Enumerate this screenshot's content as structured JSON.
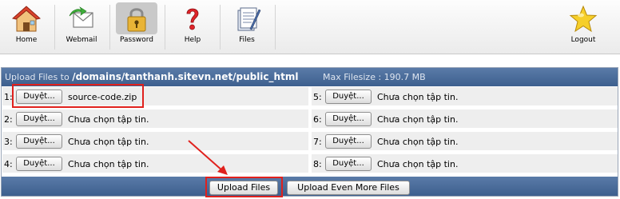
{
  "toolbar": {
    "items": [
      {
        "label": "Home",
        "icon": "home-icon"
      },
      {
        "label": "Webmail",
        "icon": "webmail-icon"
      },
      {
        "label": "Password",
        "icon": "lock-icon"
      },
      {
        "label": "Help",
        "icon": "help-icon"
      },
      {
        "label": "Files",
        "icon": "files-icon"
      }
    ],
    "logout": {
      "label": "Logout",
      "icon": "star-icon"
    }
  },
  "upload": {
    "prefix": "Upload Files to",
    "path": "/domains/tanthanh.sitevn.net/public_html",
    "max_filesize": "Max Filesize : 190.7 MB",
    "browse_label": "Duyệt...",
    "left_rows": [
      {
        "num": "1:",
        "file": "source-code.zip"
      },
      {
        "num": "2:",
        "file": "Chưa chọn tập tin."
      },
      {
        "num": "3:",
        "file": "Chưa chọn tập tin."
      },
      {
        "num": "4:",
        "file": "Chưa chọn tập tin."
      }
    ],
    "right_rows": [
      {
        "num": "5:",
        "file": "Chưa chọn tập tin."
      },
      {
        "num": "6:",
        "file": "Chưa chọn tập tin."
      },
      {
        "num": "7:",
        "file": "Chưa chọn tập tin."
      },
      {
        "num": "8:",
        "file": "Chưa chọn tập tin."
      }
    ],
    "upload_button": "Upload Files",
    "more_button": "Upload Even More Files"
  },
  "colors": {
    "header_blue": "#4a6c9b",
    "row_gray": "#eeeeee",
    "highlight_red": "#e0211d"
  }
}
